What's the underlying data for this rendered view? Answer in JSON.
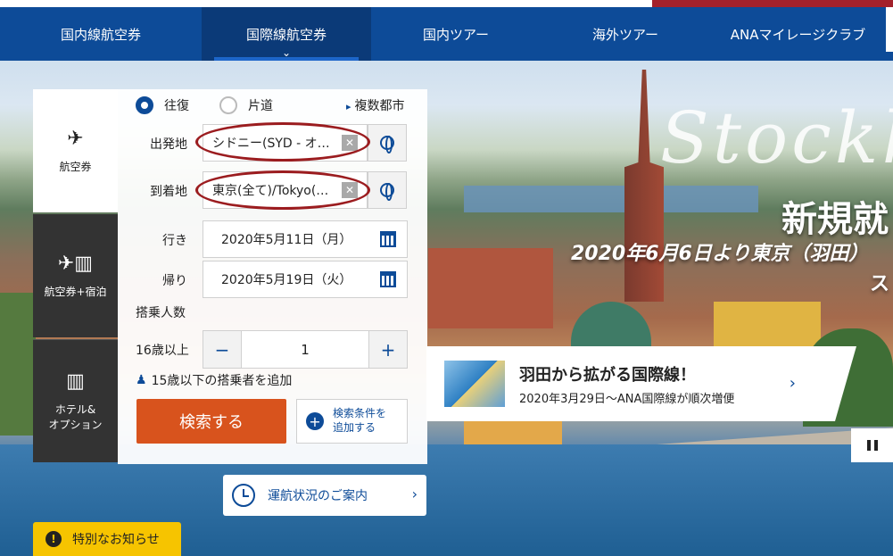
{
  "nav": {
    "items": [
      {
        "label": "国内線航空券"
      },
      {
        "label": "国際線航空券",
        "active": true
      },
      {
        "label": "国内ツアー"
      },
      {
        "label": "海外ツアー"
      },
      {
        "label": "ANAマイレージクラブ"
      }
    ]
  },
  "hero": {
    "script_text": "Stockh",
    "headline": "新規就",
    "subheadline": "2020年6月6日より東京（羽田）",
    "subheadline_tail": "ス"
  },
  "side_tabs": [
    {
      "label": "航空券",
      "icon": "airplane-icon",
      "active": true
    },
    {
      "label": "航空券+宿泊",
      "icon": "plane-hotel-icon"
    },
    {
      "label": "ホテル&\nオプション",
      "icon": "building-icon"
    }
  ],
  "search": {
    "trip_types": [
      {
        "label": "往復",
        "selected": true
      },
      {
        "label": "片道",
        "selected": false
      }
    ],
    "multi_city": "複数都市",
    "departure": {
      "label": "出発地",
      "value": "シドニー(SYD - オ…"
    },
    "arrival": {
      "label": "到着地",
      "value": "東京(全て)/Tokyo(…"
    },
    "outbound": {
      "label": "行き",
      "value": "2020年5月11日（月）"
    },
    "return": {
      "label": "帰り",
      "value": "2020年5月19日（火）"
    },
    "passengers_heading": "搭乗人数",
    "adult": {
      "label": "16歳以上",
      "value": "1",
      "minus": "−",
      "plus": "+"
    },
    "add_child": "15歳以下の搭乗者を追加",
    "search_button": "検索する",
    "conditions_button": "検索条件を\n追加する"
  },
  "operation_status": "運航状況のご案内",
  "notice": "特別なお知らせ",
  "promo": {
    "title": "羽田から拡がる国際線！",
    "subtitle": "2020年3月29日～ANA国際線が順次増便"
  },
  "colors": {
    "nav_bg": "#0d4b98",
    "accent_red": "#9b1c1f",
    "search_button": "#d8531d",
    "notice_bg": "#f6c400",
    "side_tab_dark": "#333333"
  }
}
